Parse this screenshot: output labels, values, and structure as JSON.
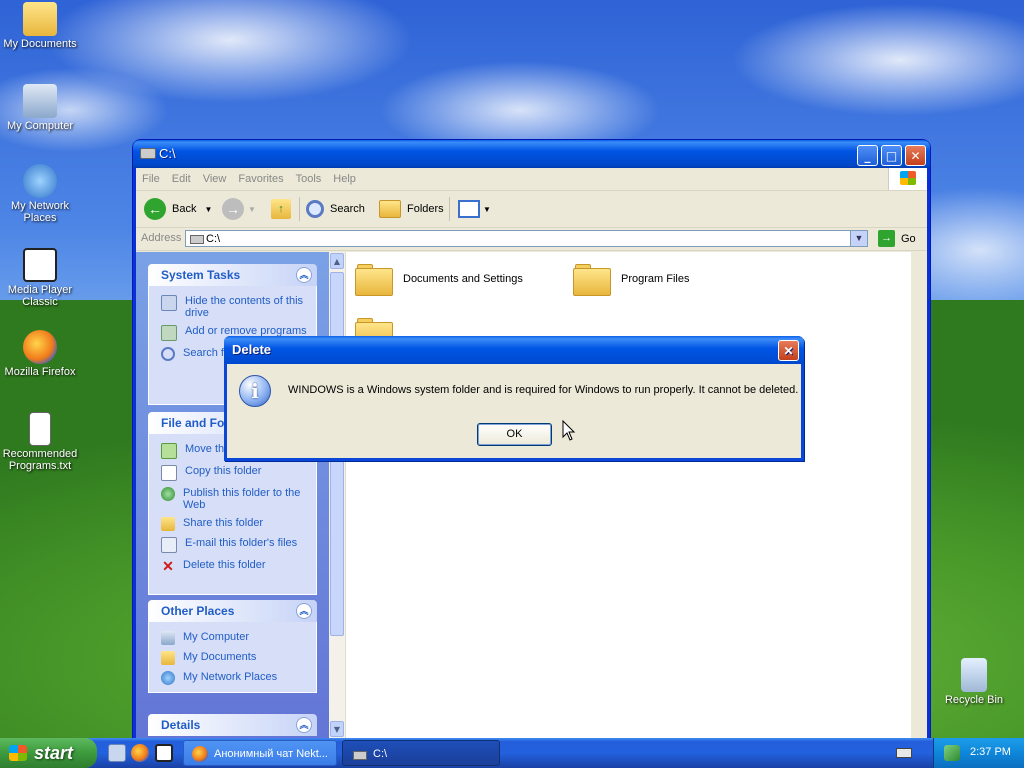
{
  "desktop": {
    "icons": [
      {
        "label": "My Documents"
      },
      {
        "label": "My Computer"
      },
      {
        "label": "My Network Places"
      },
      {
        "label": "Media Player Classic"
      },
      {
        "label": "Mozilla Firefox"
      },
      {
        "label": "Recommended Programs.txt"
      },
      {
        "label": "Recycle Bin"
      }
    ]
  },
  "window": {
    "title": "C:\\",
    "menu": [
      "File",
      "Edit",
      "View",
      "Favorites",
      "Tools",
      "Help"
    ],
    "toolbar": {
      "back": "Back",
      "search": "Search",
      "folders": "Folders"
    },
    "address": {
      "label": "Address",
      "value": "C:\\",
      "go": "Go"
    },
    "system_tasks": {
      "title": "System Tasks",
      "items": [
        "Hide the contents of this drive",
        "Add or remove programs",
        "Search for files or folders"
      ]
    },
    "file_folder_tasks": {
      "title": "File and Folder Tasks",
      "items": [
        "Move this folder",
        "Copy this folder",
        "Publish this folder to the Web",
        "Share this folder",
        "E-mail this folder's files",
        "Delete this folder"
      ]
    },
    "other_places": {
      "title": "Other Places",
      "items": [
        "My Computer",
        "My Documents",
        "My Network Places"
      ]
    },
    "details": {
      "title": "Details"
    },
    "folders": [
      "Documents and Settings",
      "Program Files"
    ]
  },
  "dialog": {
    "title": "Delete",
    "message": "WINDOWS is a Windows system folder and is required for Windows to run properly. It cannot be deleted.",
    "ok": "OK"
  },
  "taskbar": {
    "start": "start",
    "tasks": [
      "Анонимный чат Nekt...",
      "C:\\"
    ],
    "clock": "2:37 PM"
  },
  "colors": {
    "xp_blue": "#0054e3",
    "task_link": "#215dc6",
    "start_green": "#3c9a3c"
  }
}
